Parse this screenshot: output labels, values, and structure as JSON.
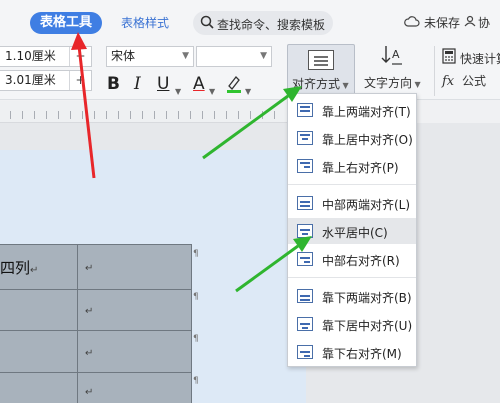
{
  "tabs": {
    "active": "表格工具",
    "second": "表格样式"
  },
  "search": {
    "placeholder": "查找命令、搜索模板"
  },
  "status": {
    "unsaved": "未保存",
    "collab": "协"
  },
  "ribbon": {
    "row_height": "1.10厘米",
    "col_width": "3.01厘米",
    "minus": "−",
    "plus": "+",
    "font_name": "宋体",
    "bold": "B",
    "italic": "I",
    "underline": "U",
    "font_color": "A",
    "align_button": "对齐方式",
    "text_direction": "文字方向",
    "quick_calc": "快速计算",
    "formula_icon": "fx",
    "formula": "公式"
  },
  "document": {
    "cell_text": "四列",
    "cell_mark": "↵",
    "pilcrow": "¶"
  },
  "menu": {
    "items": [
      {
        "label": "靠上两端对齐(T)",
        "icon": "align-top-justify-icon"
      },
      {
        "label": "靠上居中对齐(O)",
        "icon": "align-top-center-icon"
      },
      {
        "label": "靠上右对齐(P)",
        "icon": "align-top-right-icon"
      },
      {
        "label": "中部两端对齐(L)",
        "icon": "align-middle-justify-icon"
      },
      {
        "label": "水平居中(C)",
        "icon": "align-middle-center-icon"
      },
      {
        "label": "中部右对齐(R)",
        "icon": "align-middle-right-icon"
      },
      {
        "label": "靠下两端对齐(B)",
        "icon": "align-bottom-justify-icon"
      },
      {
        "label": "靠下居中对齐(U)",
        "icon": "align-bottom-center-icon"
      },
      {
        "label": "靠下右对齐(M)",
        "icon": "align-bottom-right-icon"
      }
    ],
    "selected": "水平居中(C)"
  },
  "colors": {
    "accent": "#3f7ee3",
    "red_arrow": "#e8262a",
    "green_arrow": "#2fb52f",
    "table_cell": "#a8b2bc"
  }
}
